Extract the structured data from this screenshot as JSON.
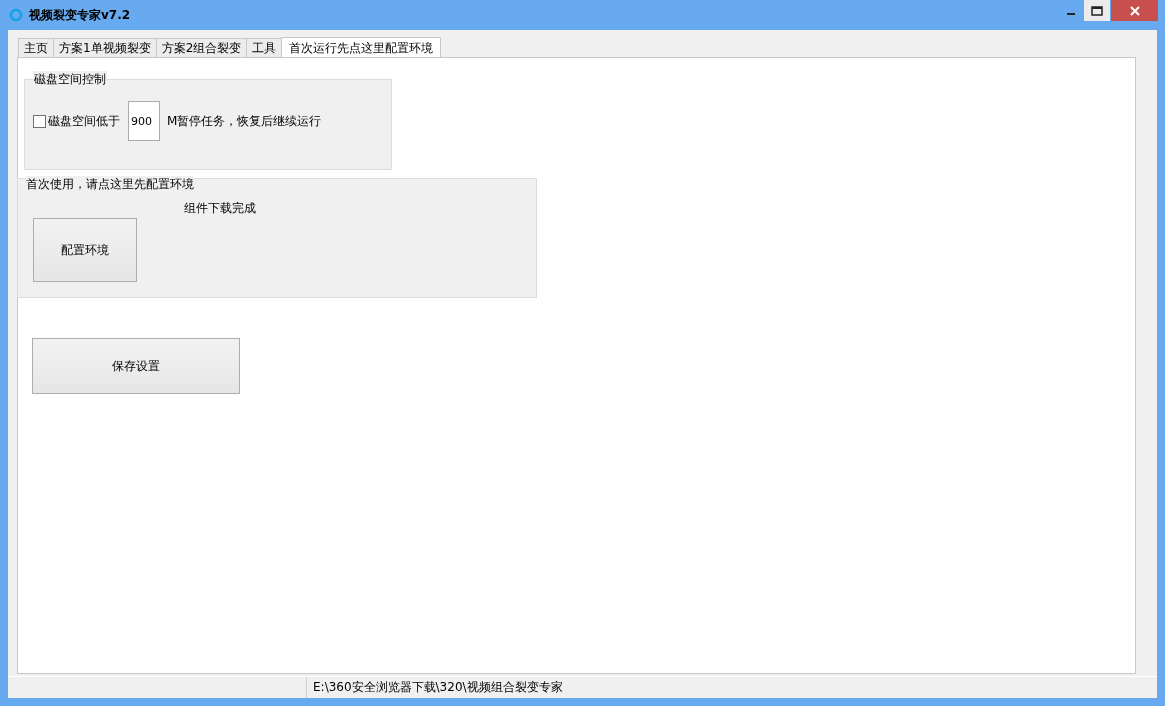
{
  "window": {
    "title": "视频裂变专家v7.2"
  },
  "tabs": [
    {
      "label": "主页",
      "selected": false
    },
    {
      "label": "方案1单视频裂变",
      "selected": false
    },
    {
      "label": "方案2组合裂变",
      "selected": false
    },
    {
      "label": "工具",
      "selected": false
    },
    {
      "label": "首次运行先点这里配置环境",
      "selected": true
    }
  ],
  "disk_group": {
    "title": "磁盘空间控制",
    "checkbox": {
      "label": "磁盘空间低于",
      "checked": false
    },
    "value": "900",
    "suffix": "M暂停任务，恢复后继续运行"
  },
  "env_group": {
    "title": "首次使用，请点这里先配置环境",
    "status": "组件下载完成",
    "button": "配置环境"
  },
  "save_button": "保存设置",
  "status_bar": {
    "path": "E:\\360安全浏览器下载\\320\\视频组合裂变专家"
  }
}
